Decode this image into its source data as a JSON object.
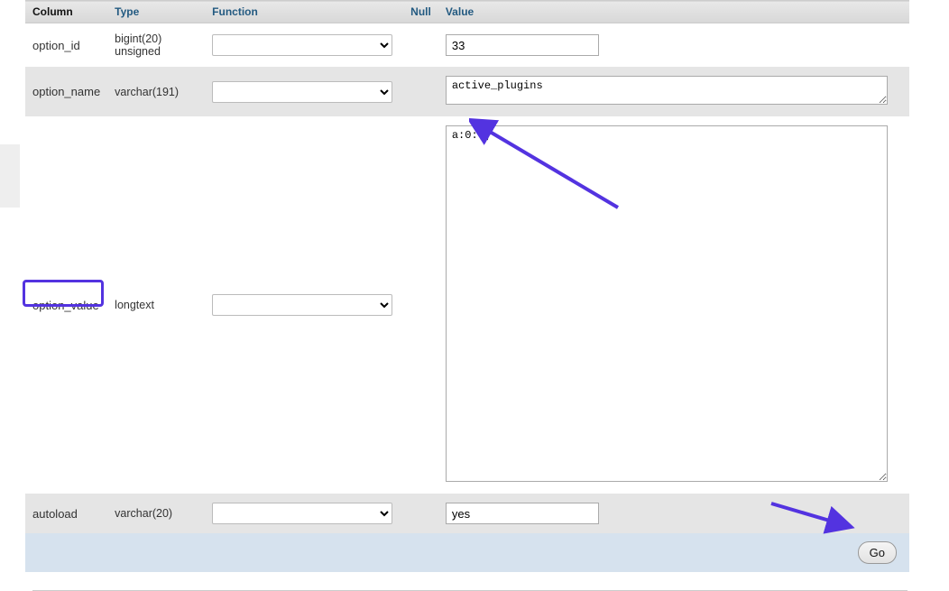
{
  "headers": {
    "column": "Column",
    "type": "Type",
    "function": "Function",
    "null": "Null",
    "value": "Value"
  },
  "rows": {
    "0": {
      "column": "option_id",
      "type": "bigint(20) unsigned",
      "value": "33"
    },
    "1": {
      "column": "option_name",
      "type": "varchar(191)",
      "value": "active_plugins"
    },
    "2": {
      "column": "option_value",
      "type": "longtext",
      "value": "a:0:{}"
    },
    "3": {
      "column": "autoload",
      "type": "varchar(20)",
      "value": "yes"
    }
  },
  "actions": {
    "go": "Go"
  },
  "chart_data": {
    "type": "table",
    "title": "",
    "xlabel": "",
    "ylabel": "",
    "columns": [
      "Column",
      "Type",
      "Function",
      "Null",
      "Value"
    ],
    "series": [
      {
        "name": "option_id",
        "values": [
          "bigint(20) unsigned",
          "",
          "",
          "33"
        ]
      },
      {
        "name": "option_name",
        "values": [
          "varchar(191)",
          "",
          "",
          "active_plugins"
        ]
      },
      {
        "name": "option_value",
        "values": [
          "longtext",
          "",
          "",
          "a:0:{}"
        ]
      },
      {
        "name": "autoload",
        "values": [
          "varchar(20)",
          "",
          "",
          "yes"
        ]
      }
    ]
  }
}
